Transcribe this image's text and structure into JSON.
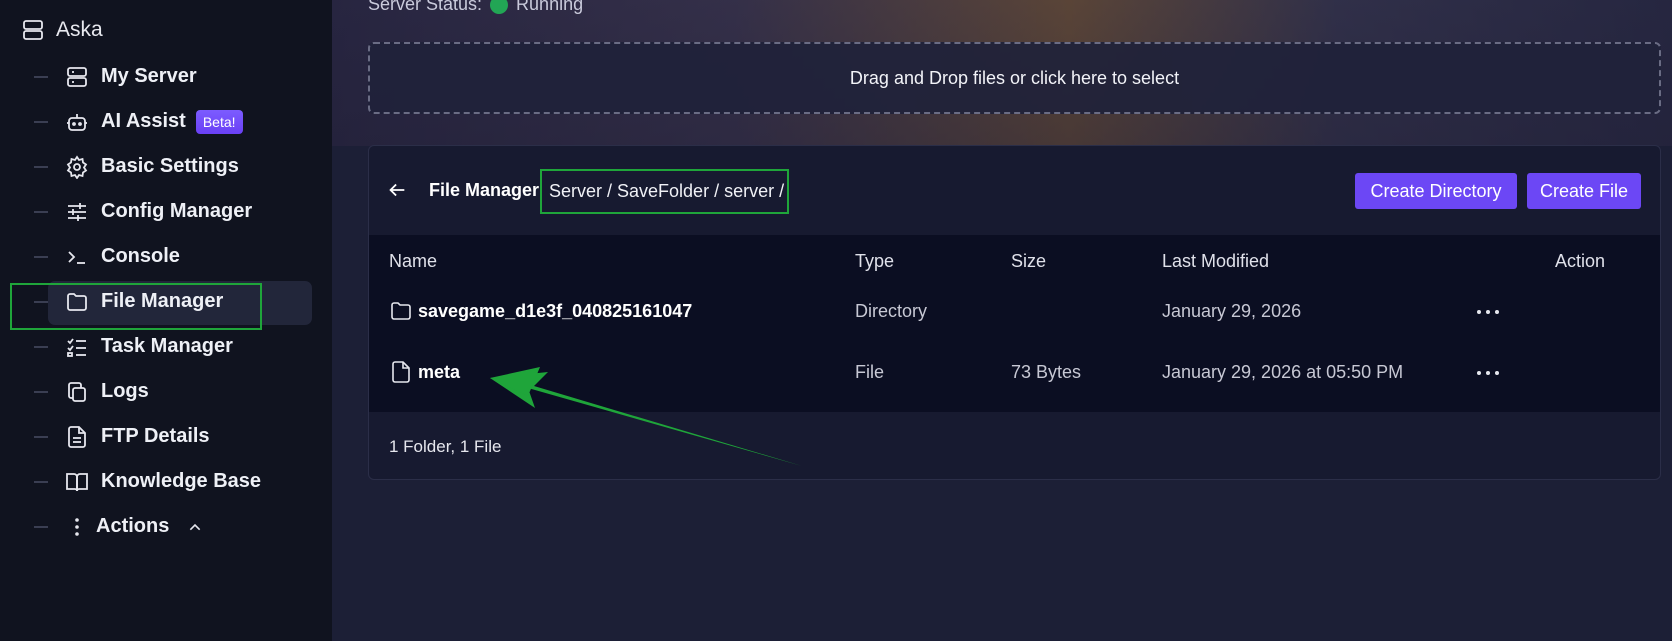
{
  "sidebar": {
    "server_name": "Aska",
    "items": [
      {
        "label": "My Server"
      },
      {
        "label": "AI Assist",
        "badge": "Beta!"
      },
      {
        "label": "Basic Settings"
      },
      {
        "label": "Config Manager"
      },
      {
        "label": "Console"
      },
      {
        "label": "File Manager"
      },
      {
        "label": "Task Manager"
      },
      {
        "label": "Logs"
      },
      {
        "label": "FTP Details"
      },
      {
        "label": "Knowledge Base"
      },
      {
        "label": "Actions"
      }
    ]
  },
  "server_status": {
    "label": "Server Status:",
    "value": "Running",
    "color": "#22a655"
  },
  "dropzone": {
    "text": "Drag and Drop files or click here to select"
  },
  "file_manager": {
    "title": "File Manager",
    "breadcrumb": "Server / SaveFolder / server /",
    "create_directory_label": "Create Directory",
    "create_file_label": "Create File",
    "columns": {
      "name": "Name",
      "type": "Type",
      "size": "Size",
      "modified": "Last Modified",
      "action": "Action"
    },
    "rows": [
      {
        "name": "savegame_d1e3f_040825161047",
        "type": "Directory",
        "size": "",
        "modified": "January 29, 2026",
        "icon": "folder-icon"
      },
      {
        "name": "meta",
        "type": "File",
        "size": "73 Bytes",
        "modified": "January 29, 2026 at 05:50 PM",
        "icon": "file-icon"
      }
    ],
    "summary": "1 Folder, 1 File"
  },
  "colors": {
    "accent": "#6c47f5",
    "highlight": "#1fa53a",
    "annotation_arrow": "#1fa53a"
  }
}
